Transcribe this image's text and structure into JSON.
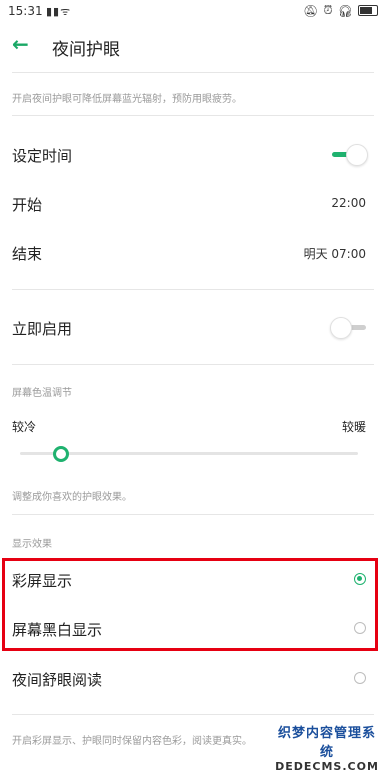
{
  "status_bar": {
    "time": "15:31",
    "left_icons": "▮▮ᯤ",
    "right_icons": [
      "bell-off-icon",
      "alarm-icon",
      "headphones-icon",
      "battery-icon"
    ]
  },
  "header": {
    "title": "夜间护眼"
  },
  "intro_hint": "开启夜间护眼可降低屏幕蓝光辐射，预防用眼疲劳。",
  "schedule": {
    "label": "设定时间",
    "enabled": true,
    "start_label": "开始",
    "start_value": "22:00",
    "end_label": "结束",
    "end_value": "明天 07:00"
  },
  "enable_now": {
    "label": "立即启用",
    "enabled": false
  },
  "color_temp": {
    "section_title": "屏幕色温调节",
    "cool_label": "较冷",
    "warm_label": "较暖",
    "level": 0.11,
    "hint": "调整成你喜欢的护眼效果。"
  },
  "display_effect": {
    "section_title": "显示效果",
    "options": [
      {
        "label": "彩屏显示",
        "selected": true
      },
      {
        "label": "屏幕黑白显示",
        "selected": false
      },
      {
        "label": "夜间舒眼阅读",
        "selected": false
      }
    ],
    "hint": "开启彩屏显示、护眼同时保留内容色彩，阅读更真实。"
  },
  "watermark": {
    "line1": "织梦内容管理系统",
    "line2": "DEDECMS.COM"
  },
  "colors": {
    "accent": "#1fb26f",
    "highlight": "#e60012"
  }
}
